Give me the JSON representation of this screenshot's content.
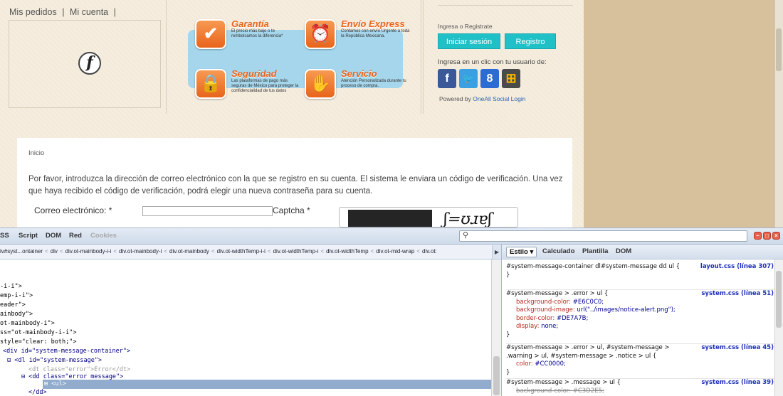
{
  "site": {
    "nav": [
      "Mis pedidos",
      "|",
      "Mi cuenta",
      "|"
    ],
    "features": [
      {
        "icon": "checkmark-icon",
        "glyph": "✔",
        "title": "Garantía",
        "desc": "El precio más bajo o te rembolsamos la diferencia*"
      },
      {
        "icon": "alarm-clock-icon",
        "glyph": "⏰",
        "title": "Envío Express",
        "desc": "Contamos con envío Urgente a toda la República Mexicana."
      },
      {
        "icon": "padlock-icon",
        "glyph": "🔒",
        "title": "Seguridad",
        "desc": "Las plataformas de pago más seguras de México para proteger la confidencialidad de tus datos"
      },
      {
        "icon": "hand-icon",
        "glyph": "✋",
        "title": "Servicio",
        "desc": "Atención Personalizada durante tu proceso de compra."
      }
    ],
    "login": {
      "title": "Ingresa o Registrate",
      "login_button": "Iniciar sesión",
      "register_button": "Registro",
      "oneclick": "Ingresa en un clic con tu usuario de:",
      "powered_prefix": "Powered by ",
      "powered_link": "OneAll Social Login",
      "social": [
        {
          "name": "facebook",
          "glyph": "f",
          "color": "#3b5998"
        },
        {
          "name": "twitter",
          "glyph": "🐦",
          "color": "#3aa0e0"
        },
        {
          "name": "google",
          "glyph": "8",
          "color": "#2c6bd2"
        },
        {
          "name": "windows",
          "glyph": "⊞",
          "color": "#f25022"
        }
      ]
    },
    "breadcrumb": "Inicio",
    "intro": "Por favor, introduzca la dirección de correo electrónico con la que se registro en su cuenta. El sistema le enviara un código de verificación. Una vez que haya recibido el código de verificación, podrá elegir una nueva contraseña para su cuenta.",
    "email_label": "Correo electrónico: *",
    "email_value": "",
    "captcha_label": "Captcha *",
    "captcha_text": "ʃ=ʊɹɐʃ"
  },
  "devtools": {
    "tabs": [
      "SS",
      "Script",
      "DOM",
      "Red",
      "Cookies"
    ],
    "search_placeholder": "",
    "path": [
      "iv#syst...ontainer",
      "div",
      "div.ot-mainbody-i-i",
      "div.ot-mainbody-i",
      "div.ot-mainbody",
      "div.ot-widthTemp-i-i",
      "div.ot-widthTemp-i",
      "div.ot-widthTemp",
      "div.ot-mid-wrap",
      "div.ot:"
    ],
    "html_lines": [
      {
        "indent": 0,
        "text": "-i-i\">"
      },
      {
        "indent": 0,
        "text": "emp-i-i\">"
      },
      {
        "indent": 0,
        "text": "eader\">"
      },
      {
        "indent": 0,
        "text": "ainbody\">"
      },
      {
        "indent": 0,
        "text": "ot-mainbody-i\">"
      },
      {
        "indent": 0,
        "text": "ss=\"ot-mainbody-i-i\">"
      },
      {
        "indent": 0,
        "text": "style=\"clear: both;\">"
      },
      {
        "indent": 1,
        "text": "<div id=\"system-message-container\">"
      },
      {
        "indent": 2,
        "text": "⊟ <dl id=\"system-message\">"
      },
      {
        "indent": 3,
        "text": "<dt class=\"error\">Error</dt>"
      },
      {
        "indent": 3,
        "text": "⊟ <dd class=\"error message\">"
      },
      {
        "indent": 4,
        "text": "⊞ <ul>"
      },
      {
        "indent": 3,
        "text": "</dd>"
      }
    ],
    "style_tabs": [
      "Estilo ▾",
      "Calculado",
      "Plantilla",
      "DOM"
    ],
    "rules": [
      {
        "selector": "#system-message-container dl#system-message dd ul {",
        "source": "layout.css (línea 307)",
        "props": [],
        "close": "}"
      },
      {
        "selector": "#system-message > .error > ul {",
        "source": "system.css (línea 51)",
        "props": [
          {
            "name": "background-color",
            "value": "#E6C0C0;",
            "strike": false
          },
          {
            "name": "background-image",
            "value": "url(\"../images/notice-alert.png\");",
            "strike": false
          },
          {
            "name": "border-color",
            "value": "#DE7A7B;",
            "strike": false
          },
          {
            "name": "display",
            "value": "none;",
            "strike": false
          }
        ],
        "close": "}"
      },
      {
        "selector": "#system-message > .error > ul, #system-message > .warning > ul, #system-message > .notice > ul {",
        "source": "system.css (línea 45)",
        "props": [
          {
            "name": "color",
            "value": "#CC0000;",
            "strike": false
          }
        ],
        "close": "}"
      },
      {
        "selector": "#system-message > .message > ul {",
        "source": "system.css (línea 39)",
        "props": [
          {
            "name": "background-color",
            "value": "#C3D2E5;",
            "strike": true
          }
        ],
        "close": ""
      }
    ]
  }
}
